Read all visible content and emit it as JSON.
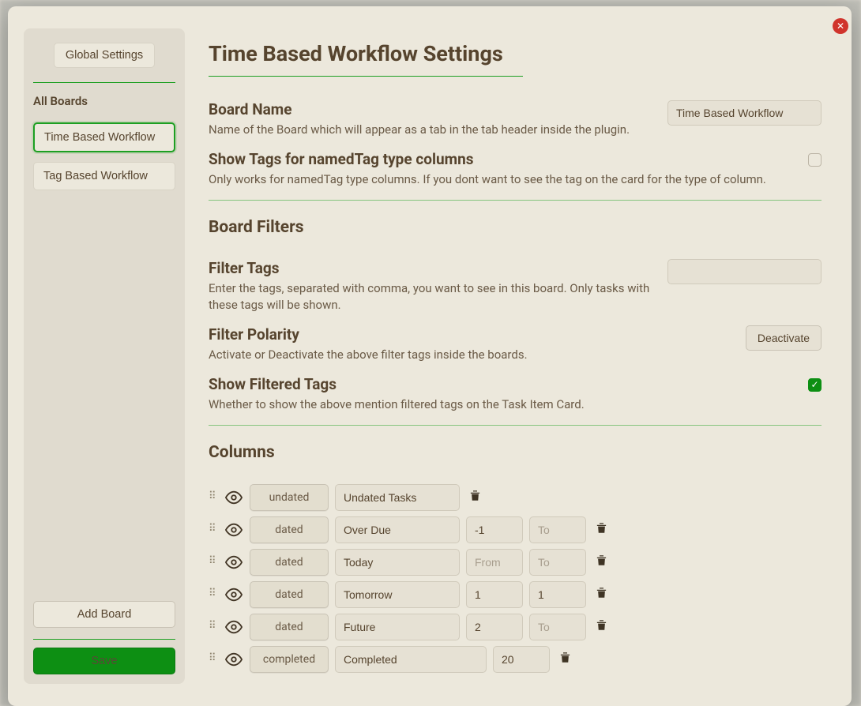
{
  "close_label": "✕",
  "sidebar": {
    "global_settings_label": "Global Settings",
    "all_boards_label": "All Boards",
    "boards": [
      {
        "label": "Time Based Workflow",
        "active": true
      },
      {
        "label": "Tag Based Workflow",
        "active": false
      }
    ],
    "add_board_label": "Add Board",
    "save_label": "Save"
  },
  "main": {
    "page_title": "Time Based Workflow Settings",
    "board_name": {
      "title": "Board Name",
      "desc": "Name of the Board which will appear as a tab in the tab header inside the plugin.",
      "value": "Time Based Workflow"
    },
    "show_tags": {
      "title": "Show Tags for namedTag type columns",
      "desc": "Only works for namedTag type columns. If you dont want to see the tag on the card for the type of column.",
      "checked": false
    },
    "board_filters_title": "Board Filters",
    "filter_tags": {
      "title": "Filter Tags",
      "desc": "Enter the tags, separated with comma, you want to see in this board. Only tasks with these tags will be shown.",
      "value": ""
    },
    "filter_polarity": {
      "title": "Filter Polarity",
      "desc": "Activate or Deactivate the above filter tags inside the boards.",
      "button_label": "Deactivate"
    },
    "show_filtered": {
      "title": "Show Filtered Tags",
      "desc": "Whether to show the above mention filtered tags on the Task Item Card.",
      "checked": true
    },
    "columns_title": "Columns",
    "from_placeholder": "From",
    "to_placeholder": "To",
    "columns": [
      {
        "type": "undated",
        "name": "Undated Tasks",
        "from": "",
        "to": "",
        "has_range": false
      },
      {
        "type": "dated",
        "name": "Over Due",
        "from": "-1",
        "to": "",
        "has_range": true
      },
      {
        "type": "dated",
        "name": "Today",
        "from": "",
        "to": "",
        "has_range": true
      },
      {
        "type": "dated",
        "name": "Tomorrow",
        "from": "1",
        "to": "1",
        "has_range": true
      },
      {
        "type": "dated",
        "name": "Future",
        "from": "2",
        "to": "",
        "has_range": true
      },
      {
        "type": "completed",
        "name": "Completed",
        "from": "20",
        "to": "",
        "has_range": true,
        "wide": true
      }
    ]
  }
}
